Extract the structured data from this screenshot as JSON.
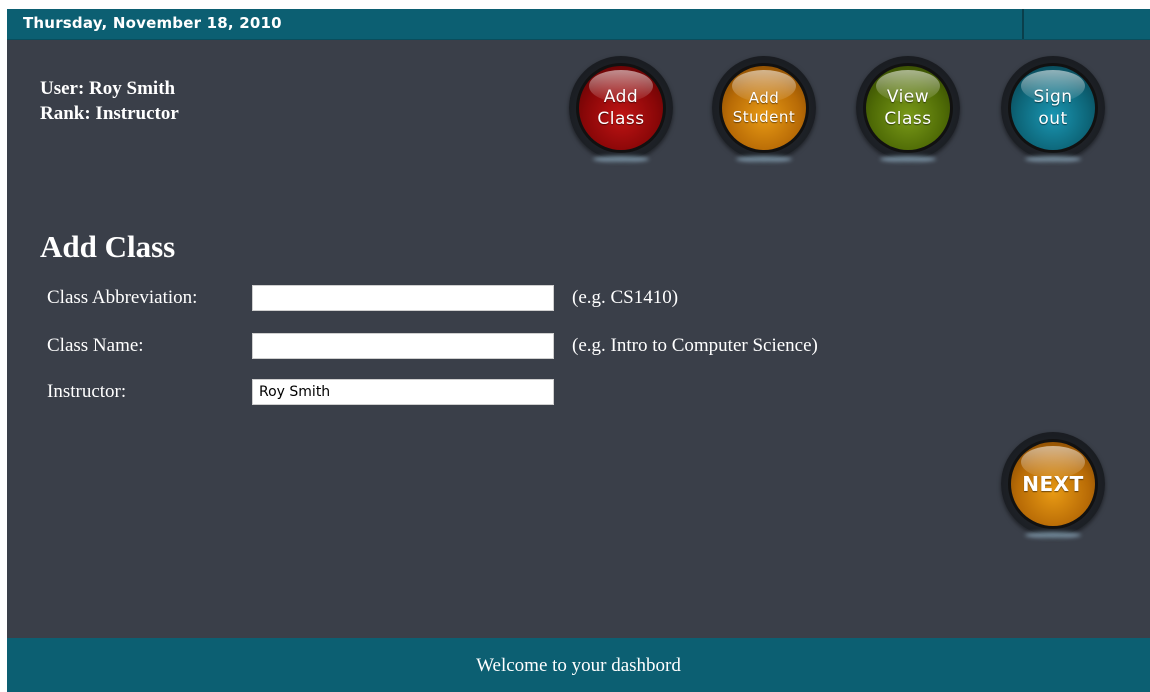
{
  "header": {
    "date": "Thursday, November 18, 2010"
  },
  "user": {
    "user_line": "User: Roy Smith",
    "rank_line": "Rank: Instructor"
  },
  "nav": {
    "add_class": "Add\nClass",
    "add_student": "Add\nStudent",
    "view_class": "View\nClass",
    "sign_out": "Sign\nout"
  },
  "form": {
    "title": "Add Class",
    "fields": [
      {
        "label": "Class Abbreviation:",
        "value": "",
        "hint": "(e.g. CS1410)"
      },
      {
        "label": "Class Name:",
        "value": "",
        "hint": "(e.g. Intro to Computer Science)"
      },
      {
        "label": "Instructor:",
        "value": "Roy Smith"
      }
    ],
    "next_label": "NEXT"
  },
  "footer": {
    "message": "Welcome to your dashbord"
  },
  "colors": {
    "bar": "#0c5f72",
    "background": "#3a3f49",
    "add_class": "#8a0708",
    "add_student": "#b86b06",
    "view_class": "#4f6b06",
    "sign_out": "#0d6578",
    "next": "#b86b06"
  }
}
